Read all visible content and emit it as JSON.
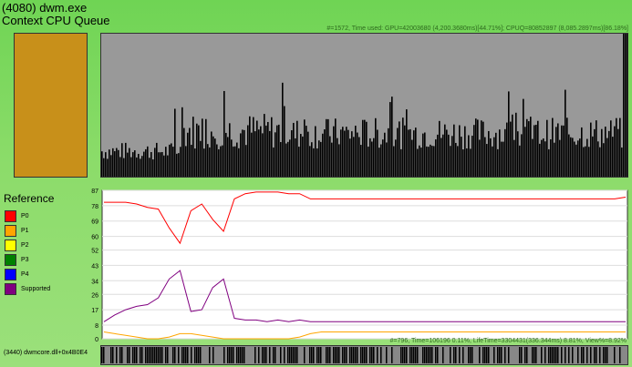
{
  "window": {
    "title": "(4080) dwm.exe",
    "subtitle": "Context CPU Queue"
  },
  "top_panel": {
    "info": "#=1572, Time used: GPU=42003680 (4,200.3680ms)[44.71%]; CPUQ=80852897 (8,085.2897ms)[86.18%]",
    "swatch_color": "#c8901a"
  },
  "legend": {
    "title": "Reference",
    "items": [
      {
        "label": "P0",
        "color": "#ff0000"
      },
      {
        "label": "P1",
        "color": "#ffa500"
      },
      {
        "label": "P2",
        "color": "#ffff00"
      },
      {
        "label": "P3",
        "color": "#008000"
      },
      {
        "label": "P4",
        "color": "#0000ff"
      },
      {
        "label": "Supported",
        "color": "#800080"
      }
    ]
  },
  "chart_data": {
    "type": "line",
    "ylim": [
      0,
      87
    ],
    "yticks": [
      0,
      8,
      17,
      26,
      34,
      43,
      52,
      60,
      69,
      78,
      87
    ],
    "grid": true,
    "series": [
      {
        "name": "P0",
        "color": "#ff0000",
        "values": [
          80,
          80,
          80,
          79,
          77,
          76,
          65,
          56,
          75,
          79,
          70,
          63,
          82,
          85,
          86,
          86,
          86,
          85,
          85,
          82,
          82,
          82,
          82,
          82,
          82,
          82,
          82,
          82,
          82,
          82,
          82,
          82,
          82,
          82,
          82,
          82,
          82,
          82,
          82,
          82,
          82,
          82,
          82,
          82,
          82,
          82,
          82,
          82,
          83
        ]
      },
      {
        "name": "P1",
        "color": "#ffa500",
        "values": [
          4,
          3,
          2,
          1,
          0,
          0,
          1,
          3,
          3,
          2,
          1,
          0,
          0,
          0,
          0,
          0,
          0,
          0,
          1,
          3,
          4,
          4,
          4,
          4,
          4,
          4,
          4,
          4,
          4,
          4,
          4,
          4,
          4,
          4,
          4,
          4,
          4,
          4,
          4,
          4,
          4,
          4,
          4,
          4,
          4,
          4,
          4,
          4,
          4
        ]
      },
      {
        "name": "Supported",
        "color": "#800080",
        "values": [
          10,
          14,
          17,
          19,
          20,
          24,
          35,
          40,
          16,
          17,
          30,
          35,
          12,
          11,
          11,
          10,
          11,
          10,
          11,
          10,
          10,
          10,
          10,
          10,
          10,
          10,
          10,
          10,
          10,
          10,
          10,
          10,
          10,
          10,
          10,
          10,
          10,
          10,
          10,
          10,
          10,
          10,
          10,
          10,
          10,
          10,
          10,
          10,
          10
        ]
      }
    ]
  },
  "bottom": {
    "info": "#=796, Time=106196 0.11%, LifeTime=3304431(336.344ms) 8.81%, View%=8.92%",
    "label": "(3440) dwmcore.dll+0x4B0E4"
  }
}
